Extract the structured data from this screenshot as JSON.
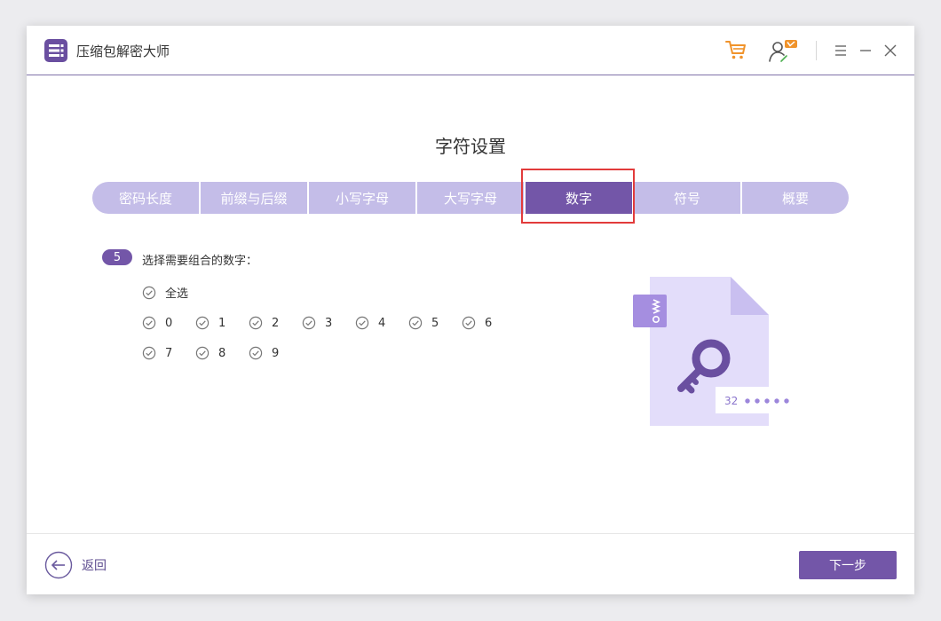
{
  "app": {
    "title": "压缩包解密大师"
  },
  "page": {
    "title": "字符设置"
  },
  "tabs": [
    {
      "label": "密码长度"
    },
    {
      "label": "前缀与后缀"
    },
    {
      "label": "小写字母"
    },
    {
      "label": "大写字母"
    },
    {
      "label": "数字"
    },
    {
      "label": "符号"
    },
    {
      "label": "概要"
    }
  ],
  "active_tab_index": 4,
  "step": {
    "number": "5",
    "label": "选择需要组合的数字："
  },
  "select_all": {
    "label": "全选"
  },
  "digits": [
    "0",
    "1",
    "2",
    "3",
    "4",
    "5",
    "6",
    "7",
    "8",
    "9"
  ],
  "illustration": {
    "sample_text": "32"
  },
  "footer": {
    "back_label": "返回",
    "next_label": "下一步"
  },
  "colors": {
    "accent": "#7356a8",
    "tab_inactive": "#c4bde8",
    "highlight": "#e23b3b",
    "cart": "#f0932b"
  }
}
